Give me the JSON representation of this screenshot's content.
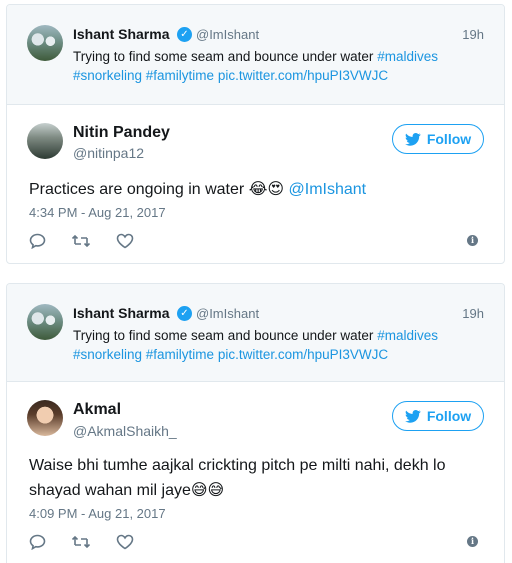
{
  "colors": {
    "accent": "#1da1f2",
    "link": "#1b95e0",
    "muted": "#657786",
    "border": "#e1e8ed",
    "quote_bg": "#f5f8fa"
  },
  "tweets": [
    {
      "quoted": {
        "name": "Ishant Sharma",
        "handle": "@ImIshant",
        "time": "19h",
        "text": "Trying to find some seam and bounce under water",
        "tags": "#maldives #snorkeling #familytime",
        "link": "pic.twitter.com/hpuPI3VWJC"
      },
      "author": {
        "name": "Nitin Pandey",
        "handle": "@nitinpa12"
      },
      "follow_label": "Follow",
      "text": "Practices are ongoing in water",
      "emojis": "😂😍",
      "mention": "@ImIshant",
      "date": "4:34 PM - Aug 21, 2017"
    },
    {
      "quoted": {
        "name": "Ishant Sharma",
        "handle": "@ImIshant",
        "time": "19h",
        "text": "Trying to find some seam and bounce under water",
        "tags": "#maldives #snorkeling #familytime",
        "link": "pic.twitter.com/hpuPI3VWJC"
      },
      "author": {
        "name": "Akmal",
        "handle": "@AkmalShaikh_"
      },
      "follow_label": "Follow",
      "text": "Waise bhi tumhe aajkal crickting pitch pe milti nahi, dekh lo shayad wahan mil jaye",
      "emojis": "😅😅",
      "date": "4:09 PM - Aug 21, 2017"
    }
  ],
  "icons": [
    "reply-icon",
    "retweet-icon",
    "like-icon",
    "info-icon",
    "verified-icon",
    "twitter-bird-icon"
  ]
}
